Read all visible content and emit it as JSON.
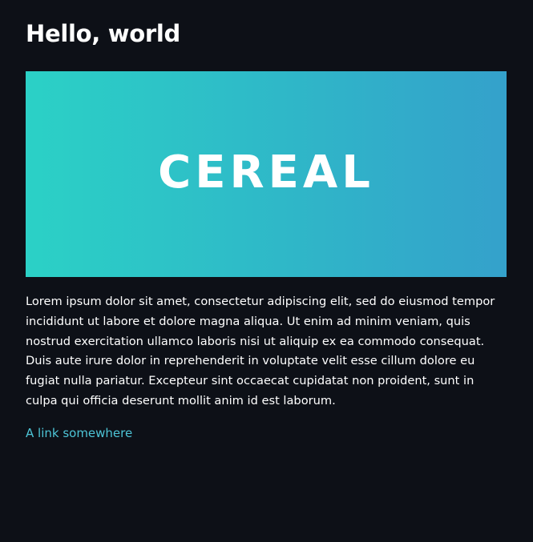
{
  "page": {
    "title": "Hello, world",
    "banner_text": "CEREAL",
    "paragraph": "Lorem ipsum dolor sit amet, consectetur adipiscing elit, sed do eiusmod tempor incididunt ut labore et dolore magna aliqua. Ut enim ad minim veniam, quis nostrud exercitation ullamco laboris nisi ut aliquip ex ea commodo consequat. Duis aute irure dolor in reprehenderit in voluptate velit esse cillum dolore eu fugiat nulla pariatur. Excepteur sint occaecat cupidatat non proident, sunt in culpa qui officia deserunt mollit anim id est laborum.",
    "link_text": "A link somewhere"
  },
  "colors": {
    "background": "#0d1017",
    "text": "#ffffff",
    "link": "#4dc4d6",
    "banner_gradient_start": "#2bd1c6",
    "banner_gradient_end": "#34a1cb"
  }
}
